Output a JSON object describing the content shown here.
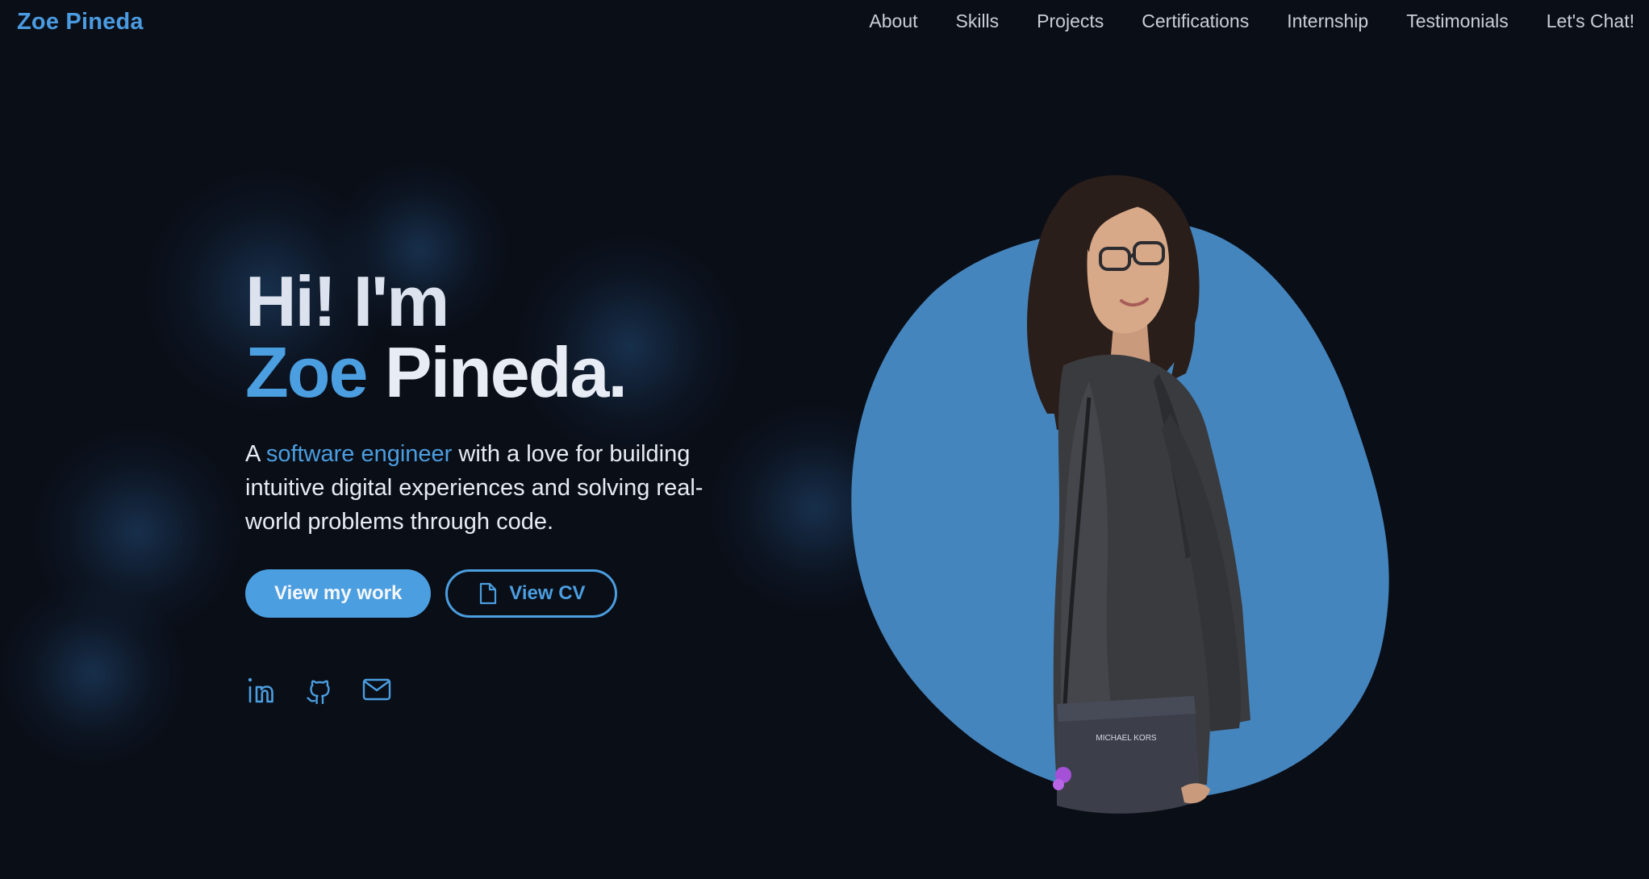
{
  "nav": {
    "brand": "Zoe Pineda",
    "links": [
      "About",
      "Skills",
      "Projects",
      "Certifications",
      "Internship",
      "Testimonials",
      "Let's Chat!"
    ]
  },
  "hero": {
    "greeting": "Hi! I'm",
    "first_name": "Zoe",
    "last_name": "Pineda.",
    "tagline_prefix": "A ",
    "tagline_accent": "software engineer",
    "tagline_suffix": " with a love for building intuitive digital experiences and solving real-world problems through code.",
    "primary_button": "View my work",
    "secondary_button": "View CV"
  },
  "socials": {
    "icons": [
      "linkedin-icon",
      "github-icon",
      "mail-icon"
    ]
  },
  "portrait": {
    "bag_brand": "MICHAEL KORS"
  },
  "colors": {
    "background": "#0a0e17",
    "accent": "#4b9ee0",
    "blob": "#4585bd",
    "text": "#e8ecf2"
  }
}
